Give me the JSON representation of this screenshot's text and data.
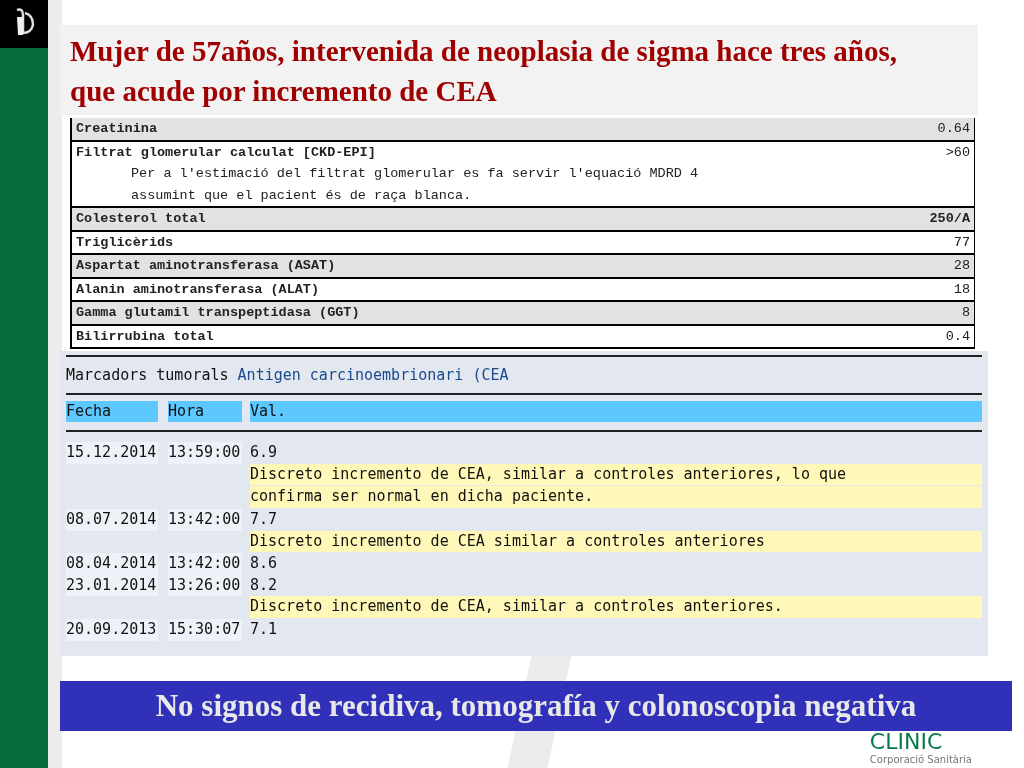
{
  "slide_title": "Mujer de 57años, intervenida de neoplasia de sigma hace tres años, que acude por incremento de CEA",
  "lab_table": {
    "rows": [
      {
        "name": "Creatinina",
        "value": "0.64",
        "flagged": false
      },
      {
        "name": "Filtrat glomerular calculat [CKD-EPI]",
        "value": ">60",
        "flagged": false,
        "note": [
          "Per a l'estimació del filtrat glomerular es fa servir l'equació MDRD 4",
          "assumint que el pacient és de raça blanca."
        ]
      },
      {
        "name": "Colesterol total",
        "value": "250/A",
        "flagged": true
      },
      {
        "name": "Triglicèrids",
        "value": "77",
        "flagged": false
      },
      {
        "name": "Aspartat aminotransferasa (ASAT)",
        "value": "28",
        "flagged": false
      },
      {
        "name": "Alanin aminotransferasa (ALAT)",
        "value": "18",
        "flagged": false
      },
      {
        "name": "Gamma glutamil transpeptidasa (GGT)",
        "value": "8",
        "flagged": false
      },
      {
        "name": "Bilirrubina total",
        "value": "0.4",
        "flagged": false
      }
    ]
  },
  "marker_panel": {
    "label": "Marcadors tumorals",
    "test": "Antigen carcinoembrionari (CEA",
    "columns": [
      "Fecha",
      "Hora",
      "Val."
    ],
    "rows": [
      {
        "date": "15.12.2014",
        "time": "13:59:00",
        "value": "6.9",
        "comment": [
          "Discreto incremento de CEA, similar a controles anteriores, lo que",
          "confirma ser normal en dicha paciente."
        ]
      },
      {
        "date": "08.07.2014",
        "time": "13:42:00",
        "value": "7.7",
        "comment": [
          "Discreto incremento de CEA similar a controles anteriores"
        ]
      },
      {
        "date": "08.04.2014",
        "time": "13:42:00",
        "value": "8.6"
      },
      {
        "date": "23.01.2014",
        "time": "13:26:00",
        "value": "8.2",
        "comment": [
          "Discreto incremento de CEA, similar a controles anteriores."
        ]
      },
      {
        "date": "20.09.2013",
        "time": "15:30:07",
        "value": "7.1"
      }
    ]
  },
  "conclusion": "No signos de recidiva, tomografía  y colonoscopia negativa",
  "footer_logo": {
    "name": "CLINIC",
    "subtitle": "Corporació Sanitària"
  }
}
